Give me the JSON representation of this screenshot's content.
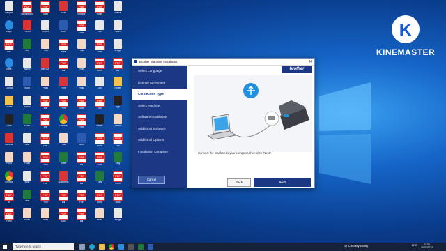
{
  "desktop": {
    "icons": [
      {
        "label": "Recycle",
        "kind": "app"
      },
      {
        "label": "Bloodhound",
        "kind": "pdf"
      },
      {
        "label": "Sales",
        "kind": "pdf"
      },
      {
        "label": "Kiosk",
        "kind": "red"
      },
      {
        "label": "Bumper",
        "kind": "pdf"
      },
      {
        "label": "Notes",
        "kind": "pdf"
      },
      {
        "label": "Notice",
        "kind": "app"
      },
      {
        "label": "Edge",
        "kind": "blu"
      },
      {
        "label": "Firefox",
        "kind": "red"
      },
      {
        "label": "Report",
        "kind": "app"
      },
      {
        "label": "Doc",
        "kind": "doc"
      },
      {
        "label": "Form",
        "kind": "pdf"
      },
      {
        "label": "List",
        "kind": "app"
      },
      {
        "label": "Scan",
        "kind": "app"
      },
      {
        "label": "File",
        "kind": "pdf"
      },
      {
        "label": "Tally",
        "kind": "xls"
      },
      {
        "label": "Photo",
        "kind": "ppl"
      },
      {
        "label": "Print",
        "kind": "pdf"
      },
      {
        "label": "Photo",
        "kind": "ppl"
      },
      {
        "label": "Scan",
        "kind": "pdf"
      },
      {
        "label": "Image",
        "kind": "app"
      },
      {
        "label": "Edge",
        "kind": "blu"
      },
      {
        "label": "Admin",
        "kind": "app"
      },
      {
        "label": "WinRAR",
        "kind": "red"
      },
      {
        "label": "Bill",
        "kind": "pdf"
      },
      {
        "label": "Photo",
        "kind": "ppl"
      },
      {
        "label": "Sheet",
        "kind": "pdf"
      },
      {
        "label": "Bill",
        "kind": "pdf"
      },
      {
        "label": "Control",
        "kind": "app"
      },
      {
        "label": "Word",
        "kind": "doc"
      },
      {
        "label": "Photo",
        "kind": "ppl"
      },
      {
        "label": "Form",
        "kind": "red"
      },
      {
        "label": "Photo",
        "kind": "ppl"
      },
      {
        "label": "Doc",
        "kind": "app"
      },
      {
        "label": "Folder",
        "kind": "fld"
      },
      {
        "label": "Folder",
        "kind": "fld"
      },
      {
        "label": "Admin",
        "kind": "app"
      },
      {
        "label": "Bill",
        "kind": "pdf"
      },
      {
        "label": "Form",
        "kind": "pdf"
      },
      {
        "label": "Scan",
        "kind": "pdf"
      },
      {
        "label": "Doc",
        "kind": "pdf"
      },
      {
        "label": "App",
        "kind": "blk"
      },
      {
        "label": "Cam",
        "kind": "blk"
      },
      {
        "label": "Excel",
        "kind": "xls"
      },
      {
        "label": "Bill",
        "kind": "pdf"
      },
      {
        "label": "Chrome",
        "kind": "chr"
      },
      {
        "label": "Form",
        "kind": "pdf"
      },
      {
        "label": "Player",
        "kind": "blk"
      },
      {
        "label": "Photo",
        "kind": "ppl"
      },
      {
        "label": "Acrobat",
        "kind": "red"
      },
      {
        "label": "Note",
        "kind": "app"
      },
      {
        "label": "File",
        "kind": "pdf"
      },
      {
        "label": "Photo",
        "kind": "ppl"
      },
      {
        "label": "Word",
        "kind": "doc"
      },
      {
        "label": "Form",
        "kind": "pdf"
      },
      {
        "label": "Doc",
        "kind": "pdf"
      },
      {
        "label": "Photo",
        "kind": "ppl"
      },
      {
        "label": "Photo",
        "kind": "ppl"
      },
      {
        "label": "Form",
        "kind": "pdf"
      },
      {
        "label": "Sheet",
        "kind": "xls"
      },
      {
        "label": "Bill",
        "kind": "pdf"
      },
      {
        "label": "Scan",
        "kind": "pdf"
      },
      {
        "label": "Tally",
        "kind": "xls"
      },
      {
        "label": "Chrome",
        "kind": "chr"
      },
      {
        "label": "Note",
        "kind": "app"
      },
      {
        "label": "File",
        "kind": "pdf"
      },
      {
        "label": "QuickHeal",
        "kind": "red"
      },
      {
        "label": "Bill",
        "kind": "pdf"
      },
      {
        "label": "Tally",
        "kind": "xls"
      },
      {
        "label": "Form",
        "kind": "pdf"
      },
      {
        "label": "Bill",
        "kind": "pdf"
      },
      {
        "label": "Tally",
        "kind": "xls"
      },
      {
        "label": "Form",
        "kind": "pdf"
      },
      {
        "label": "Bill",
        "kind": "pdf"
      },
      {
        "label": "File",
        "kind": "pdf"
      },
      {
        "label": "Form",
        "kind": "pdf"
      },
      {
        "label": "Scan",
        "kind": "pdf"
      },
      {
        "label": "Form",
        "kind": "pdf"
      },
      {
        "label": "Photo",
        "kind": "ppl"
      },
      {
        "label": "Photo",
        "kind": "ppl"
      },
      {
        "label": "Doc",
        "kind": "pdf"
      },
      {
        "label": "Bill",
        "kind": "pdf"
      },
      {
        "label": "Photo",
        "kind": "ppl"
      },
      {
        "label": "Image",
        "kind": "app"
      }
    ]
  },
  "watermark": {
    "brand": "KINEMASTER"
  },
  "installer": {
    "title": "Brother Machine Installation",
    "close": "✕",
    "brand": "brother",
    "steps": [
      "Select Language",
      "License Agreement",
      "Connection Type",
      "Select Machine",
      "Software Installation",
      "Additional Software",
      "Additional Options",
      "Installation Complete"
    ],
    "active_step": 2,
    "cancel_label": "Cancel",
    "instruction": "Connect the machine to your computer, then click \"Next\".",
    "back_label": "Back",
    "next_label": "Next"
  },
  "taskbar": {
    "search_placeholder": "Type here to search",
    "weather": "27°C  Mostly cloudy",
    "lang": "ENG",
    "time": "13:08",
    "date": "10/07/2022"
  }
}
